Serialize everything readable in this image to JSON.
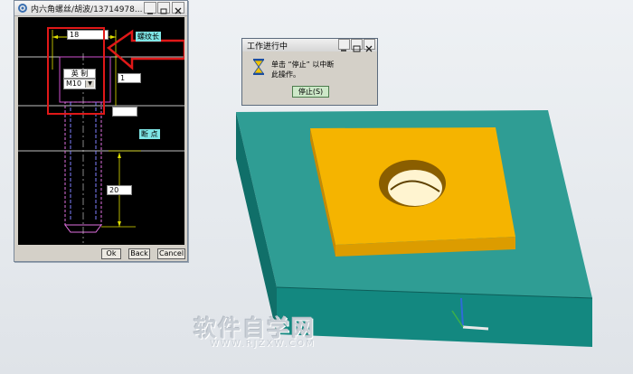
{
  "dialog": {
    "title": "内六角螺丝/胡波/13714978...",
    "fields": {
      "length_top": "18",
      "right_1": "1",
      "bottom_20": "20"
    },
    "labels": {
      "thread_length": "螺纹长",
      "break_point": "断 点",
      "unit_group": "英 制"
    },
    "size_select": {
      "value": "M10"
    },
    "buttons": {
      "ok": "Ok",
      "back": "Back",
      "cancel": "Cancel"
    }
  },
  "progress_dialog": {
    "title": "工作进行中",
    "message_line1": "单击 “停止” 以中断",
    "message_line2": "此操作。",
    "stop_button": "停止(S)"
  },
  "watermark": {
    "text": "软件自学网",
    "sub": "WWW.RJZXW.COM"
  },
  "colors": {
    "base_top": "#2f9d94",
    "base_front": "#138880",
    "block_top": "#f5b400",
    "annotation_red": "#e01818",
    "label_cyan": "#7fe6e6"
  }
}
